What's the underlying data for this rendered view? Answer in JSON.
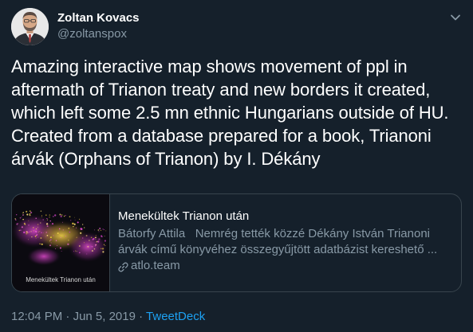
{
  "author": {
    "display_name": "Zoltan Kovacs",
    "handle": "@zoltanspox"
  },
  "tweet": {
    "text": "Amazing interactive map shows movement of ppl in\naftermath of Trianon treaty and new borders it created,\nwhich left some 2.5 mn ethnic Hungarians outside of HU.\nCreated from a database prepared for a book, Trianoni\nárvák (Orphans of Trianon) by I. Dékány"
  },
  "card": {
    "image_caption": "Menekültek Trianon után",
    "title": "Menekültek Trianon után",
    "description_line1": "Bátorfy Attila   Nemrég tették közzé Dékány István Trianoni",
    "description_line2": "árvák című könyvéhez összegyűjtött adatbázist kereshető ...",
    "domain": "atlo.team",
    "link_icon": "link-icon"
  },
  "meta": {
    "time": "12:04 PM",
    "separator1": " · ",
    "date": "Jun 5, 2019",
    "separator2": " · ",
    "source": "TweetDeck"
  },
  "colors": {
    "background": "#15202b",
    "secondary_text": "#8899a6",
    "accent": "#1da1f2",
    "border": "#38444d"
  },
  "icons": {
    "menu": "chevron-down-icon",
    "link": "link-icon"
  }
}
